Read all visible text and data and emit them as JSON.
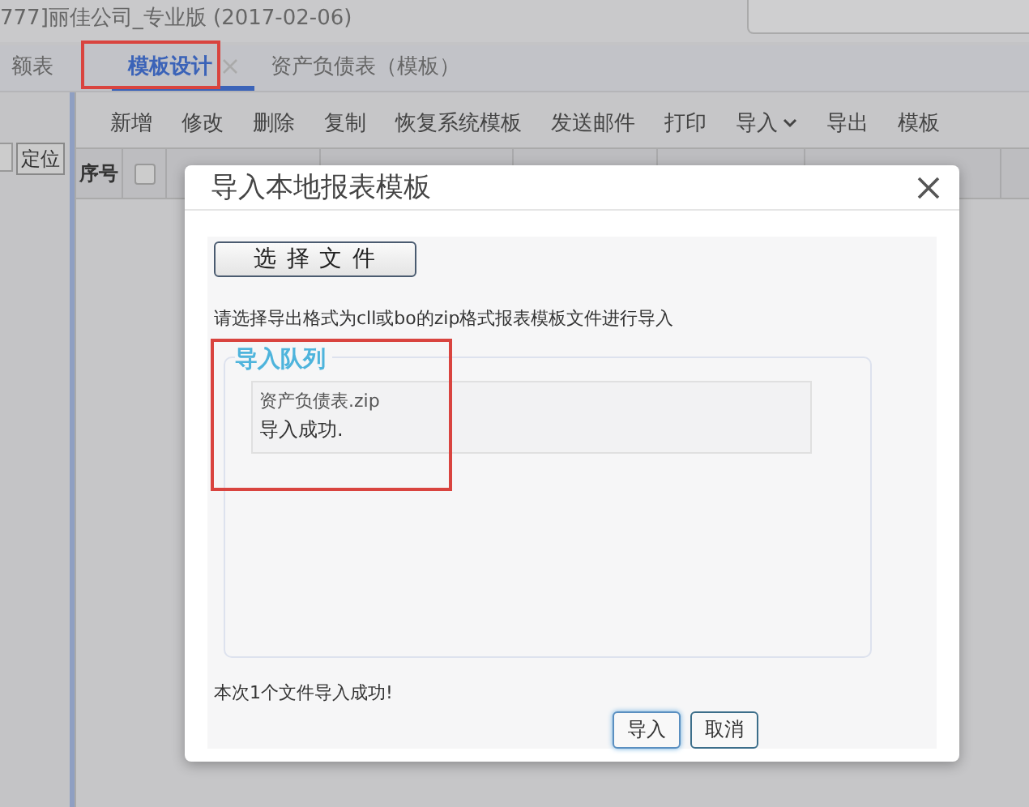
{
  "window": {
    "title": "777]丽佳公司_专业版  (2017-02-06)"
  },
  "tabs": [
    {
      "label": "额表",
      "selected": false,
      "closable": false
    },
    {
      "label": "模板设计",
      "selected": true,
      "closable": true
    },
    {
      "label": "资产负债表（模板）",
      "selected": false,
      "closable": false
    }
  ],
  "sidebar": {
    "locate_button": "定位"
  },
  "toolbar": [
    {
      "label": "新增",
      "dropdown": false
    },
    {
      "label": "修改",
      "dropdown": false
    },
    {
      "label": "删除",
      "dropdown": false
    },
    {
      "label": "复制",
      "dropdown": false
    },
    {
      "label": "恢复系统模板",
      "dropdown": false
    },
    {
      "label": "发送邮件",
      "dropdown": false
    },
    {
      "label": "打印",
      "dropdown": false
    },
    {
      "label": "导入",
      "dropdown": true
    },
    {
      "label": "导出",
      "dropdown": false
    },
    {
      "label": "模板",
      "dropdown": false
    }
  ],
  "table": {
    "columns": [
      "序号",
      ""
    ],
    "select_all_checked": false
  },
  "dialog": {
    "title": "导入本地报表模板",
    "choose_file_button": "选 择 文 件",
    "hint": "请选择导出格式为cll或bo的zip格式报表模板文件进行导入",
    "queue": {
      "legend": "导入队列",
      "items": [
        {
          "file": "资产负债表.zip",
          "status": "导入成功."
        }
      ]
    },
    "summary": "本次1个文件导入成功!",
    "buttons": [
      {
        "label": "导入",
        "primary": true
      },
      {
        "label": "取消",
        "primary": false
      }
    ]
  }
}
